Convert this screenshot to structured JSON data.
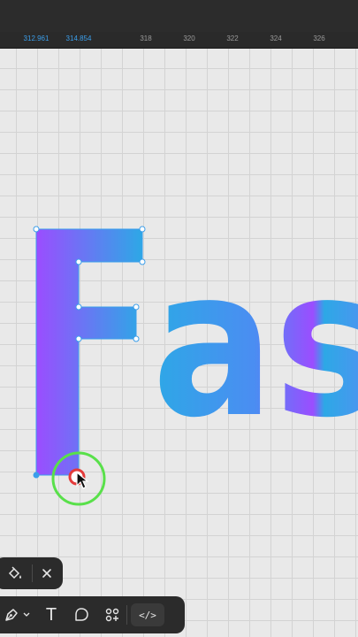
{
  "ruler": {
    "labels": [
      "312.961",
      "314.854",
      "318",
      "320",
      "322",
      "324",
      "326"
    ],
    "highlighted": [
      "312.961",
      "314.854"
    ]
  },
  "canvas": {
    "text": "Fas",
    "fill_gradient": [
      "#9b4dff",
      "#2da8e6"
    ],
    "selection_color": "#3b9eea",
    "cursor_ring_color": "#59e04a",
    "cursor_dot_color": "#e43b3b"
  },
  "toolbar_small": {
    "tools": [
      {
        "icon": "paint-bucket-icon"
      },
      {
        "icon": "close-icon"
      }
    ]
  },
  "toolbar_main": {
    "tools": [
      {
        "icon": "pen-tool-icon"
      },
      {
        "icon": "chevron-down-icon"
      },
      {
        "icon": "text-tool-icon",
        "glyph": "T"
      },
      {
        "icon": "comment-icon"
      },
      {
        "icon": "components-icon"
      },
      {
        "icon": "code-icon",
        "glyph": "</>"
      }
    ]
  }
}
